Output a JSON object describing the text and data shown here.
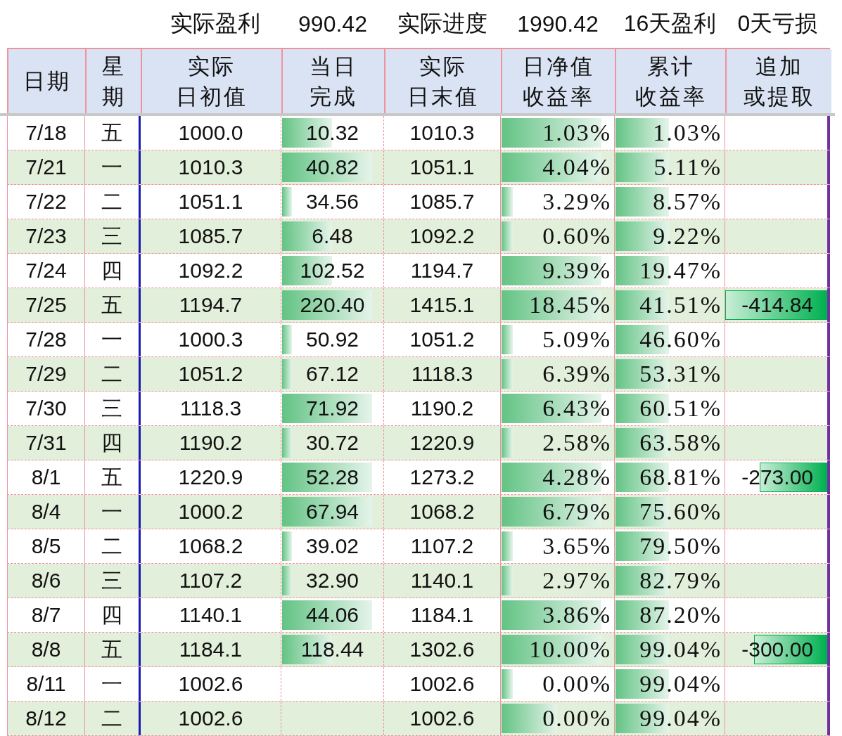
{
  "summary_row": [
    "实际盈利",
    "990.42",
    "实际进度",
    "1990.42",
    "16天盈利",
    "0天亏损"
  ],
  "columns": [
    {
      "lines": [
        "日期"
      ]
    },
    {
      "lines": [
        "星",
        "期"
      ]
    },
    {
      "lines": [
        "实际",
        "日初值"
      ]
    },
    {
      "lines": [
        "当日",
        "完成"
      ]
    },
    {
      "lines": [
        "实际",
        "日末值"
      ]
    },
    {
      "lines": [
        "日净值",
        "收益率"
      ]
    },
    {
      "lines": [
        "累计",
        "收益率"
      ]
    },
    {
      "lines": [
        "追加",
        "或提取"
      ]
    }
  ],
  "rows": [
    {
      "date": "7/18",
      "weekday": "五",
      "open": "1000.0",
      "done": {
        "text": "10.32",
        "level": 0.5
      },
      "close": "1010.3",
      "daily": {
        "text": "1.03%",
        "level": 0.9
      },
      "cumulative": {
        "text": "1.03%",
        "level": 0.5
      }
    },
    {
      "date": "7/21",
      "weekday": "一",
      "open": "1010.3",
      "done": {
        "text": "40.82",
        "level": 0.9
      },
      "close": "1051.1",
      "daily": {
        "text": "4.04%",
        "level": 0.9
      },
      "cumulative": {
        "text": "5.11%",
        "level": 0.5
      }
    },
    {
      "date": "7/22",
      "weekday": "二",
      "open": "1051.1",
      "done": {
        "text": "34.56",
        "level": 0.1
      },
      "close": "1085.7",
      "daily": {
        "text": "3.29%",
        "level": 0.1
      },
      "cumulative": {
        "text": "8.57%",
        "level": 0.5
      }
    },
    {
      "date": "7/23",
      "weekday": "三",
      "open": "1085.7",
      "done": {
        "text": "6.48",
        "level": 0.5
      },
      "close": "1092.2",
      "daily": {
        "text": "0.60%",
        "level": 0.1
      },
      "cumulative": {
        "text": "9.22%",
        "level": 0.5
      }
    },
    {
      "date": "7/24",
      "weekday": "四",
      "open": "1092.2",
      "done": {
        "text": "102.52",
        "level": 0.5
      },
      "close": "1194.7",
      "daily": {
        "text": "9.39%",
        "level": 0.9
      },
      "cumulative": {
        "text": "19.47%",
        "level": 0.5
      }
    },
    {
      "date": "7/25",
      "weekday": "五",
      "open": "1194.7",
      "done": {
        "text": "220.40",
        "level": 0.9
      },
      "close": "1415.1",
      "daily": {
        "text": "18.45%",
        "level": 0.9
      },
      "cumulative": {
        "text": "41.51%",
        "level": 0.5
      },
      "adjustment": {
        "text": "-414.84",
        "level": 1.0
      }
    },
    {
      "date": "7/28",
      "weekday": "一",
      "open": "1000.3",
      "done": {
        "text": "50.92",
        "level": 0.1
      },
      "close": "1051.2",
      "daily": {
        "text": "5.09%",
        "level": 0.1
      },
      "cumulative": {
        "text": "46.60%",
        "level": 0.5
      }
    },
    {
      "date": "7/29",
      "weekday": "二",
      "open": "1051.2",
      "done": {
        "text": "67.12",
        "level": 0.1
      },
      "close": "1118.3",
      "daily": {
        "text": "6.39%",
        "level": 0.1
      },
      "cumulative": {
        "text": "53.31%",
        "level": 0.5
      }
    },
    {
      "date": "7/30",
      "weekday": "三",
      "open": "1118.3",
      "done": {
        "text": "71.92",
        "level": 0.9
      },
      "close": "1190.2",
      "daily": {
        "text": "6.43%",
        "level": 0.9
      },
      "cumulative": {
        "text": "60.51%",
        "level": 0.5
      }
    },
    {
      "date": "7/31",
      "weekday": "四",
      "open": "1190.2",
      "done": {
        "text": "30.72",
        "level": 0.1
      },
      "close": "1220.9",
      "daily": {
        "text": "2.58%",
        "level": 0.1
      },
      "cumulative": {
        "text": "63.58%",
        "level": 0.5
      }
    },
    {
      "date": "8/1",
      "weekday": "五",
      "open": "1220.9",
      "done": {
        "text": "52.28",
        "level": 0.9
      },
      "close": "1273.2",
      "daily": {
        "text": "4.28%",
        "level": 0.9
      },
      "cumulative": {
        "text": "68.81%",
        "level": 0.5
      },
      "adjustment": {
        "text": "-273.00",
        "level": 0.66
      }
    },
    {
      "date": "8/4",
      "weekday": "一",
      "open": "1000.2",
      "done": {
        "text": "67.94",
        "level": 0.9
      },
      "close": "1068.2",
      "daily": {
        "text": "6.79%",
        "level": 0.9
      },
      "cumulative": {
        "text": "75.60%",
        "level": 0.5
      }
    },
    {
      "date": "8/5",
      "weekday": "二",
      "open": "1068.2",
      "done": {
        "text": "39.02",
        "level": 0.1
      },
      "close": "1107.2",
      "daily": {
        "text": "3.65%",
        "level": 0.1
      },
      "cumulative": {
        "text": "79.50%",
        "level": 0.5
      }
    },
    {
      "date": "8/6",
      "weekday": "三",
      "open": "1107.2",
      "done": {
        "text": "32.90",
        "level": 0.1
      },
      "close": "1140.1",
      "daily": {
        "text": "2.97%",
        "level": 0.1
      },
      "cumulative": {
        "text": "82.79%",
        "level": 0.5
      }
    },
    {
      "date": "8/7",
      "weekday": "四",
      "open": "1140.1",
      "done": {
        "text": "44.06",
        "level": 0.9
      },
      "close": "1184.1",
      "daily": {
        "text": "3.86%",
        "level": 0.9
      },
      "cumulative": {
        "text": "87.20%",
        "level": 0.5
      }
    },
    {
      "date": "8/8",
      "weekday": "五",
      "open": "1184.1",
      "done": {
        "text": "118.44",
        "level": 0.5
      },
      "close": "1302.6",
      "daily": {
        "text": "10.00%",
        "level": 0.9
      },
      "cumulative": {
        "text": "99.04%",
        "level": 0.5
      },
      "adjustment": {
        "text": "-300.00",
        "level": 0.72
      }
    },
    {
      "date": "8/11",
      "weekday": "一",
      "open": "1002.6",
      "close": "1002.6",
      "daily": {
        "text": "0.00%",
        "level": 0.1
      },
      "cumulative": {
        "text": "99.04%",
        "level": 0.5
      }
    },
    {
      "date": "8/12",
      "weekday": "二",
      "open": "1002.6",
      "close": "1002.6",
      "daily": {
        "text": "0.00%",
        "level": 0.5
      },
      "cumulative": {
        "text": "99.04%",
        "level": 0.5
      }
    }
  ]
}
